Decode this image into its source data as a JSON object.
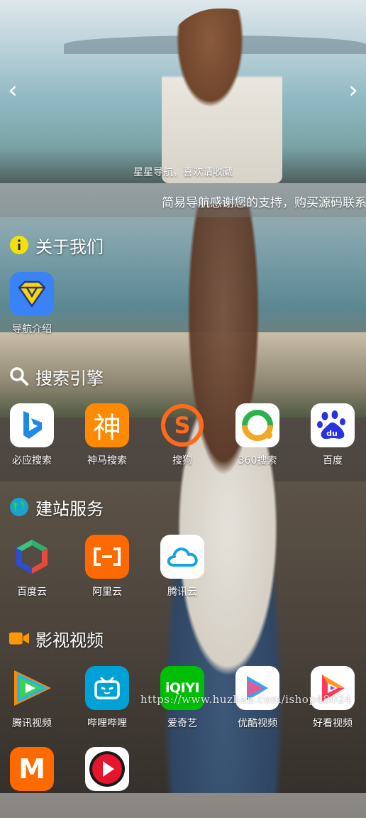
{
  "banner": {
    "caption": "星星导航，喜欢请收藏",
    "prev_icon": "chevron-left-icon",
    "next_icon": "chevron-right-icon"
  },
  "marquee": {
    "text": "简易导航感谢您的支持，购买源码联系"
  },
  "sections": {
    "about": {
      "title": "关于我们",
      "icon": "info-icon",
      "items": [
        {
          "label": "导航介绍",
          "icon": "diamond-icon"
        }
      ]
    },
    "search": {
      "title": "搜索引擎",
      "icon": "search-icon",
      "items": [
        {
          "label": "必应搜索",
          "icon": "bing-icon"
        },
        {
          "label": "神马搜索",
          "icon": "shenma-icon",
          "glyph": "神"
        },
        {
          "label": "搜狗",
          "icon": "sogou-icon",
          "glyph": "S"
        },
        {
          "label": "360搜索",
          "icon": "360-icon"
        },
        {
          "label": "百度",
          "icon": "baidu-icon",
          "glyph": "du"
        }
      ]
    },
    "build": {
      "title": "建站服务",
      "icon": "globe-icon",
      "items": [
        {
          "label": "百度云",
          "icon": "baidu-cloud-icon"
        },
        {
          "label": "阿里云",
          "icon": "aliyun-icon",
          "glyph": "[-]"
        },
        {
          "label": "腾讯云",
          "icon": "tencent-cloud-icon"
        }
      ]
    },
    "video": {
      "title": "影视视频",
      "icon": "video-camera-icon",
      "items": [
        {
          "label": "腾讯视频",
          "icon": "tencent-video-icon"
        },
        {
          "label": "哔哩哔哩",
          "icon": "bilibili-icon"
        },
        {
          "label": "爱奇艺",
          "icon": "iqiyi-icon",
          "glyph": "iQIYI"
        },
        {
          "label": "优酷视频",
          "icon": "youku-icon"
        },
        {
          "label": "好看视频",
          "icon": "haokan-icon"
        },
        {
          "label": "",
          "icon": "mango-tv-icon",
          "glyph": "M"
        },
        {
          "label": "",
          "icon": "play-red-icon"
        }
      ]
    }
  },
  "watermark": "https://www.huzhan.com/ishop48024",
  "colors": {
    "accent_yellow": "#f5e10a",
    "bing_blue": "#1e8ae6",
    "shenma_orange": "#ff8a00",
    "sogou_orange": "#ff6a1a",
    "baidu_blue": "#2932e1",
    "aliyun_orange": "#ff6a00",
    "iqiyi_green": "#00be06",
    "bilibili_blue": "#00a1d6"
  }
}
